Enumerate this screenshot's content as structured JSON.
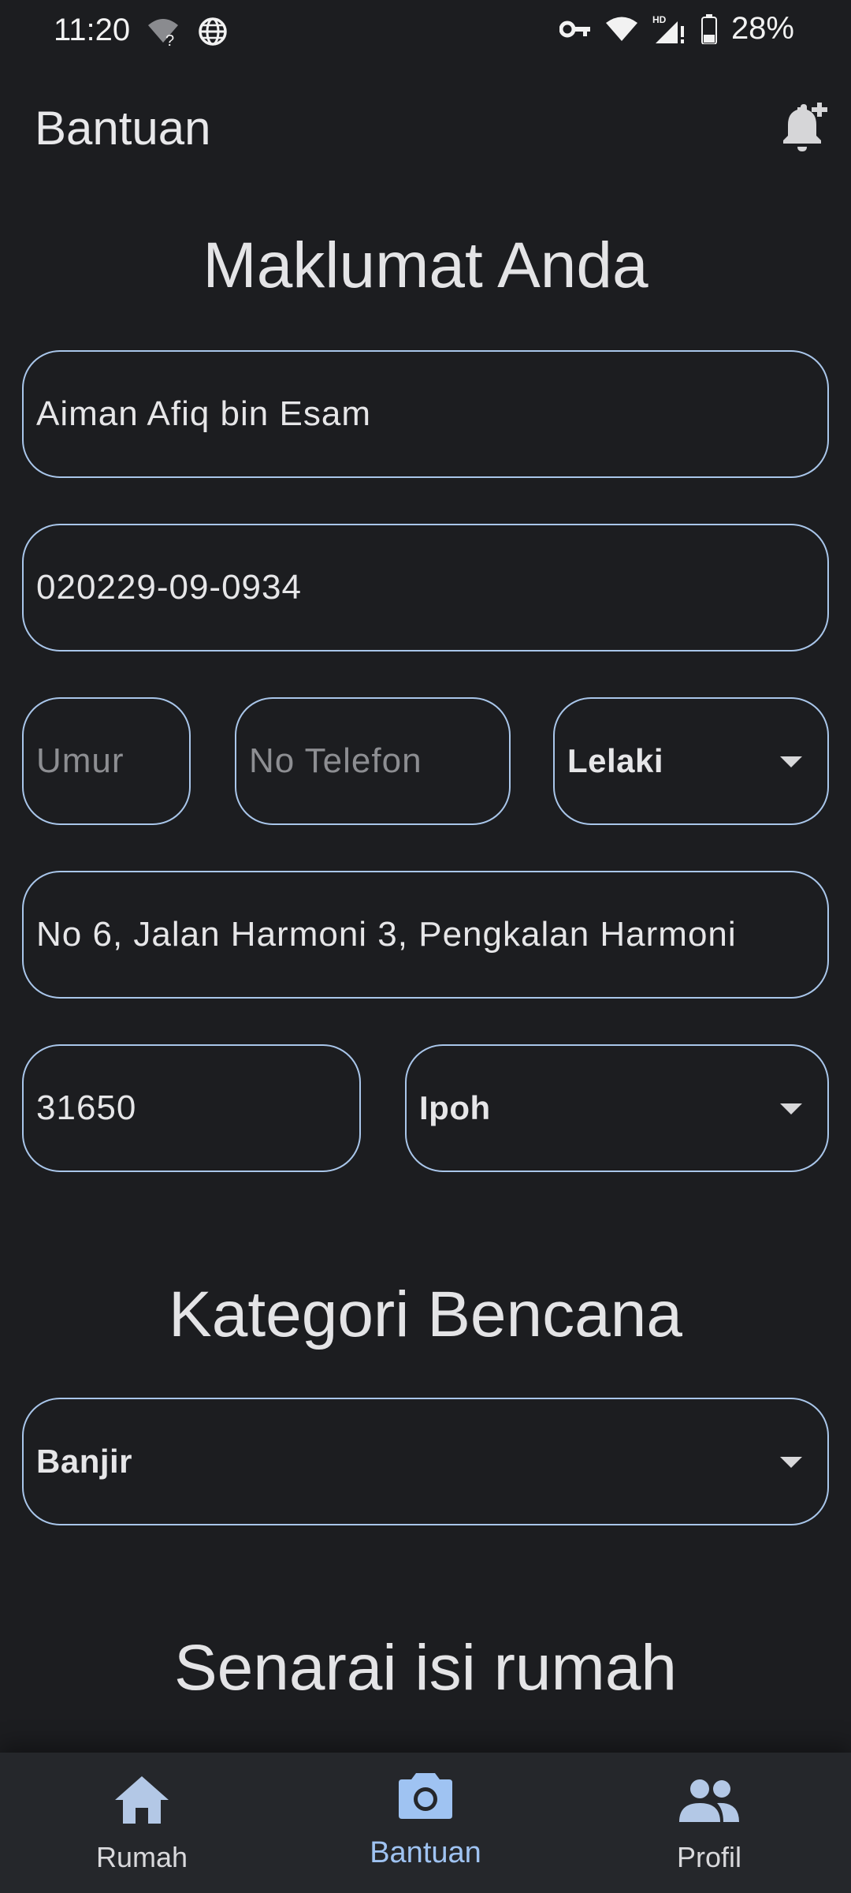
{
  "status_bar": {
    "time": "11:20",
    "battery": "28%"
  },
  "app_bar": {
    "title": "Bantuan"
  },
  "sections": {
    "maklumat_title": "Maklumat Anda",
    "kategori_title": "Kategori Bencana",
    "senarai_title": "Senarai isi rumah"
  },
  "form": {
    "name_value": "Aiman Afiq bin Esam",
    "ic_value": "020229-09-0934",
    "age_placeholder": "Umur",
    "phone_placeholder": "No Telefon",
    "gender_selected": "Lelaki",
    "address_value": "No 6, Jalan Harmoni 3, Pengkalan Harmoni",
    "postcode_value": "31650",
    "city_selected": "Ipoh",
    "disaster_selected": "Banjir"
  },
  "bottom_nav": {
    "items": [
      {
        "label": "Rumah",
        "icon": "home-icon"
      },
      {
        "label": "Bantuan",
        "icon": "camera-icon"
      },
      {
        "label": "Profil",
        "icon": "people-icon"
      }
    ]
  },
  "colors": {
    "background": "#1c1d20",
    "field_border": "#a9c6ea",
    "accent": "#9fc3f2"
  }
}
